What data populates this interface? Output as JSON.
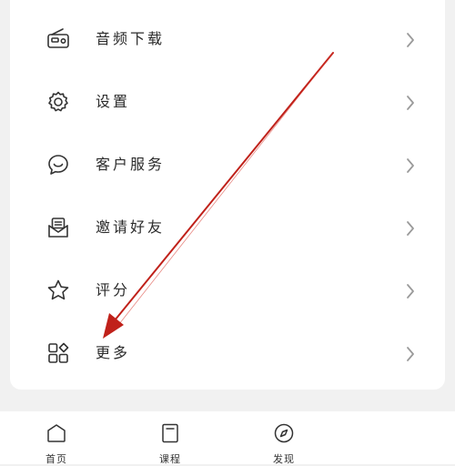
{
  "menu": {
    "items": [
      {
        "label": "音频下载",
        "icon": "radio-icon"
      },
      {
        "label": "设置",
        "icon": "gear-icon"
      },
      {
        "label": "客户服务",
        "icon": "chat-bubble-icon"
      },
      {
        "label": "邀请好友",
        "icon": "envelope-icon"
      },
      {
        "label": "评分",
        "icon": "star-icon"
      },
      {
        "label": "更多",
        "icon": "grid-icon"
      }
    ]
  },
  "tabbar": {
    "tabs": [
      {
        "label": "首页",
        "icon": "home-icon"
      },
      {
        "label": "课程",
        "icon": "book-icon"
      },
      {
        "label": "发现",
        "icon": "compass-icon"
      }
    ]
  },
  "colors": {
    "background": "#f1f1f1",
    "card": "#ffffff",
    "icon_stroke": "#333333",
    "chevron": "#9a9a9a",
    "annotation_arrow": "#c0211a"
  }
}
